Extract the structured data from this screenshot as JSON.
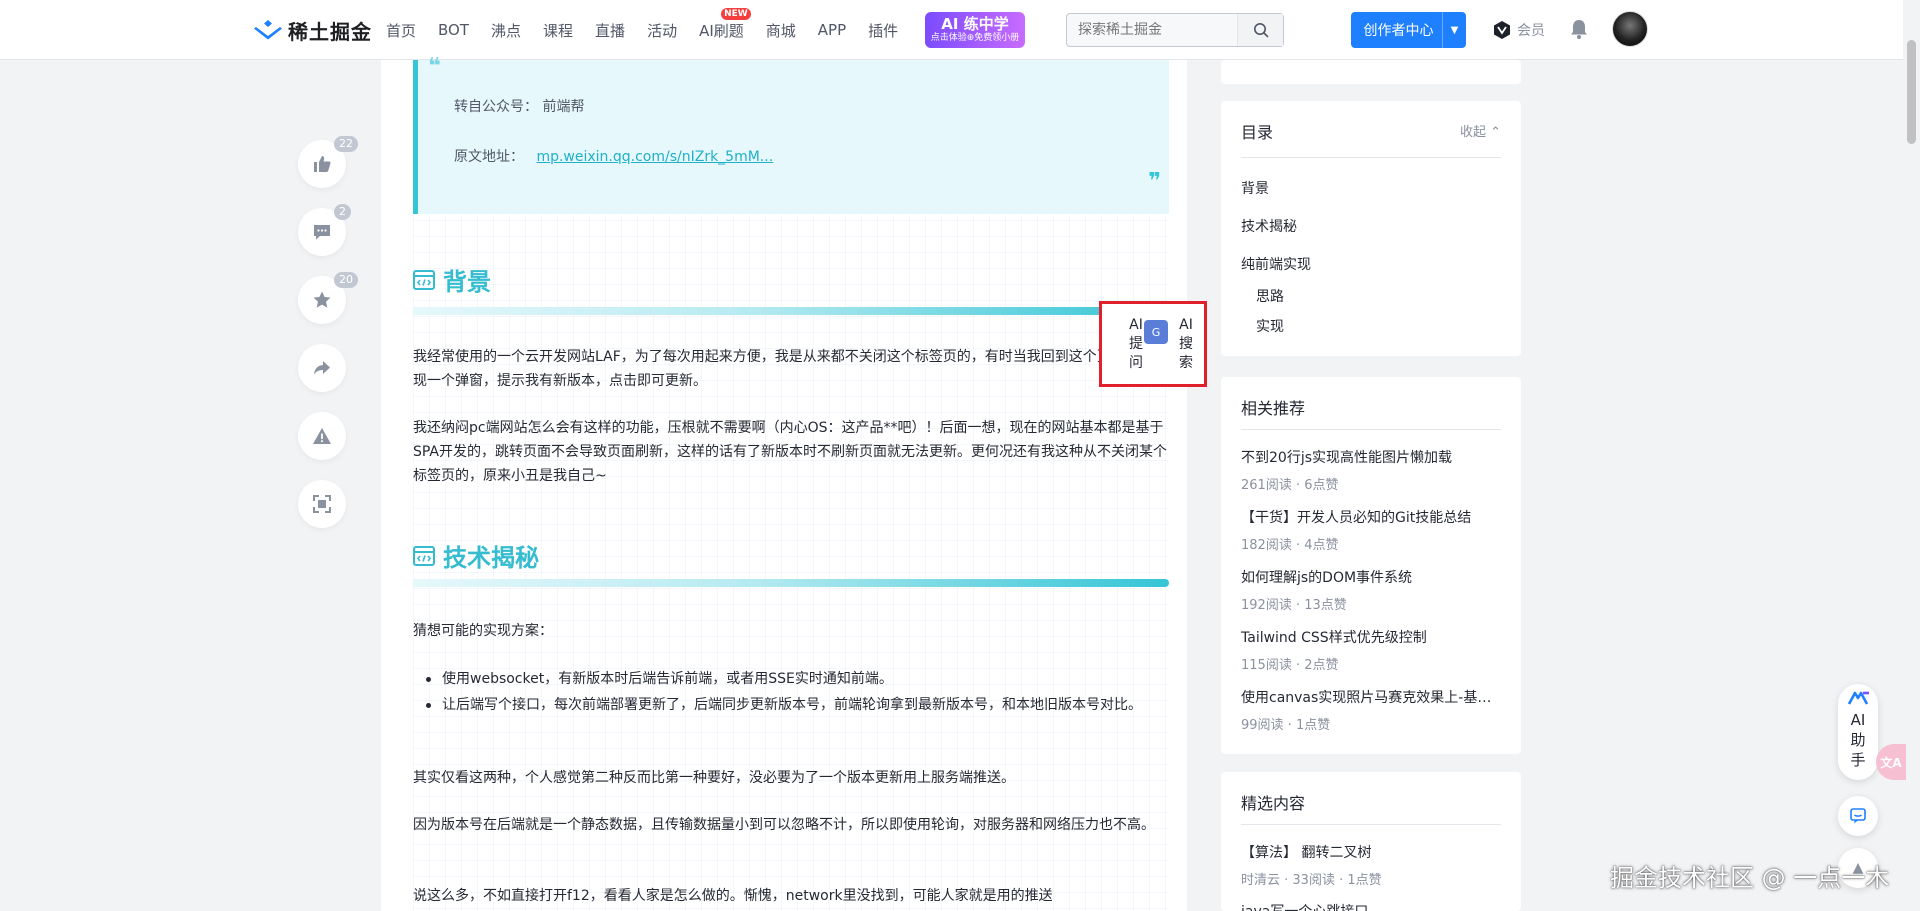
{
  "header": {
    "logo_text": "稀土掘金",
    "nav": [
      {
        "label": "首页"
      },
      {
        "label": "BOT"
      },
      {
        "label": "沸点"
      },
      {
        "label": "课程"
      },
      {
        "label": "直播"
      },
      {
        "label": "活动"
      },
      {
        "label": "AI刷题",
        "badge": "NEW"
      },
      {
        "label": "商城"
      },
      {
        "label": "APP"
      },
      {
        "label": "插件"
      }
    ],
    "promo": {
      "main": "AI 练中学",
      "sub": "点击体验⊕免费领小册"
    },
    "search_placeholder": "探索稀土掘金",
    "creator_label": "创作者中心",
    "vip_label": "会员"
  },
  "actions": {
    "like_count": "22",
    "comment_count": "2",
    "collect_count": "20"
  },
  "article": {
    "quote": {
      "source_label": "转自公众号：",
      "source_value": "前端帮",
      "link_label": "原文地址：",
      "link_text": "mp.weixin.qq.com/s/nIZrk_5mM..."
    },
    "section1_title": "背景",
    "p1": "我经常使用的一个云开发网站LAF，为了每次用起来方便，我是从来都不关闭这个标签页的，有时当我回到这个页面，就发现一个弹窗，提示我有新版本，点击即可更新。",
    "p2": "我还纳闷pc端网站怎么会有这样的功能，压根就不需要啊（内心OS：这产品**吧）！后面一想，现在的网站基本都是基于SPA开发的，跳转页面不会导致页面刷新，这样的话有了新版本时不刷新页面就无法更新。更何况还有我这种从不关闭某个标签页的，原来小丑是我自己~",
    "section2_title": "技术揭秘",
    "p3": "猜想可能的实现方案：",
    "bullets": [
      "使用websocket，有新版本时后端告诉前端，或者用SSE实时通知前端。",
      "让后端写个接口，每次前端部署更新了，后端同步更新版本号，前端轮询拿到最新版本号，和本地旧版本号对比。"
    ],
    "p4": "其实仅看这两种，个人感觉第二种反而比第一种要好，没必要为了一个版本更新用上服务端推送。",
    "p5": "因为版本号在后端就是一个静态数据，且传输数据量小到可以忽略不计，所以即使用轮询，对服务器和网络压力也不高。",
    "p6": "说这么多，不如直接打开f12，看看人家是怎么做的。惭愧，network里没找到，可能人家就是用的推送"
  },
  "ai_popup": {
    "ask_label": "AI提问",
    "search_label": "AI搜索"
  },
  "toc": {
    "title": "目录",
    "collapse_label": "收起",
    "items": [
      "背景",
      "技术揭秘",
      "纯前端实现",
      "思路",
      "实现"
    ]
  },
  "related": {
    "title": "相关推荐",
    "items": [
      {
        "title": "不到20行js实现高性能图片懒加载",
        "meta": "261阅读 · 6点赞"
      },
      {
        "title": "【干货】开发人员必知的Git技能总结",
        "meta": "182阅读 · 4点赞"
      },
      {
        "title": "如何理解js的DOM事件系统",
        "meta": "192阅读 · 13点赞"
      },
      {
        "title": "Tailwind CSS样式优先级控制",
        "meta": "115阅读 · 2点赞"
      },
      {
        "title": "使用canvas实现照片马赛克效果上-基础...",
        "meta": "99阅读 · 1点赞"
      }
    ]
  },
  "featured": {
    "title": "精选内容",
    "items": [
      {
        "title": "【算法】 翻转二叉树",
        "meta": "时清云 · 33阅读 · 1点赞"
      },
      {
        "title": "java写一个心跳接口"
      }
    ]
  },
  "ai_helper_label": "AI助手",
  "watermark": "掘金技术社区 @ 一点一木",
  "colors": {
    "accent": "#1e80ff",
    "heading": "#35bcd0",
    "highlight_box": "#e0202a"
  }
}
